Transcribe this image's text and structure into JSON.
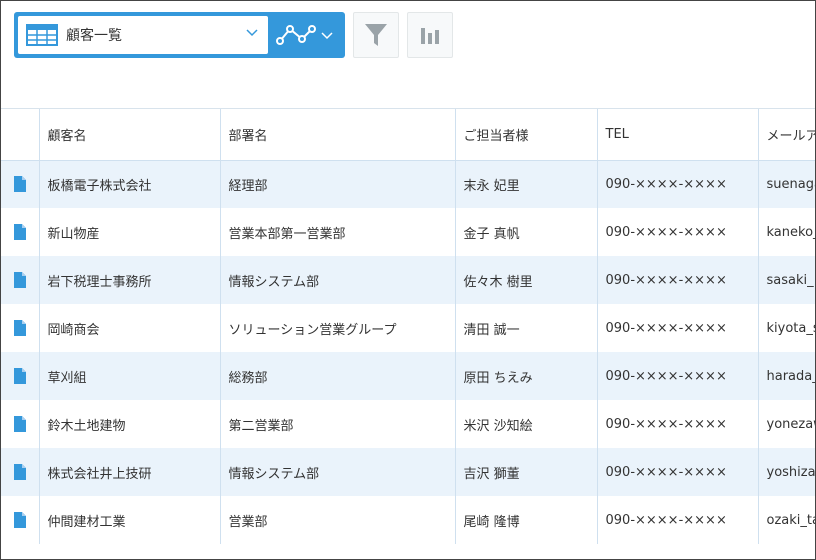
{
  "view_selector": {
    "selected_view": "顧客一覧",
    "view_icon": "table-grid-icon",
    "graph_icon": "line-graph-icon"
  },
  "toolbar": {
    "filter_icon": "filter-icon",
    "chart_icon": "bar-chart-icon"
  },
  "colors": {
    "accent": "#3498db",
    "row_stripe": "#eaf3fb",
    "doc_icon": "#3498db"
  },
  "table": {
    "columns": [
      "顧客名",
      "部署名",
      "ご担当者様",
      "TEL",
      "メールア"
    ],
    "rows": [
      [
        "板橋電子株式会社",
        "経理部",
        "末永 妃里",
        "090-××××-××××",
        "suenaga"
      ],
      [
        "新山物産",
        "営業本部第一営業部",
        "金子 真帆",
        "090-××××-××××",
        "kaneko_"
      ],
      [
        "岩下税理士事務所",
        "情報システム部",
        "佐々木 樹里",
        "090-××××-××××",
        "sasaki_"
      ],
      [
        "岡崎商会",
        "ソリューション営業グループ",
        "清田 誠一",
        "090-××××-××××",
        "kiyota_s"
      ],
      [
        "草刈組",
        "総務部",
        "原田 ちえみ",
        "090-××××-××××",
        "harada_"
      ],
      [
        "鈴木土地建物",
        "第二営業部",
        "米沢 沙知絵",
        "090-××××-××××",
        "yonezaw"
      ],
      [
        "株式会社井上技研",
        "情報システム部",
        "吉沢 獅董",
        "090-××××-××××",
        "yoshiza"
      ],
      [
        "仲間建材工業",
        "営業部",
        "尾崎 隆博",
        "090-××××-××××",
        "ozaki_ta"
      ]
    ]
  }
}
